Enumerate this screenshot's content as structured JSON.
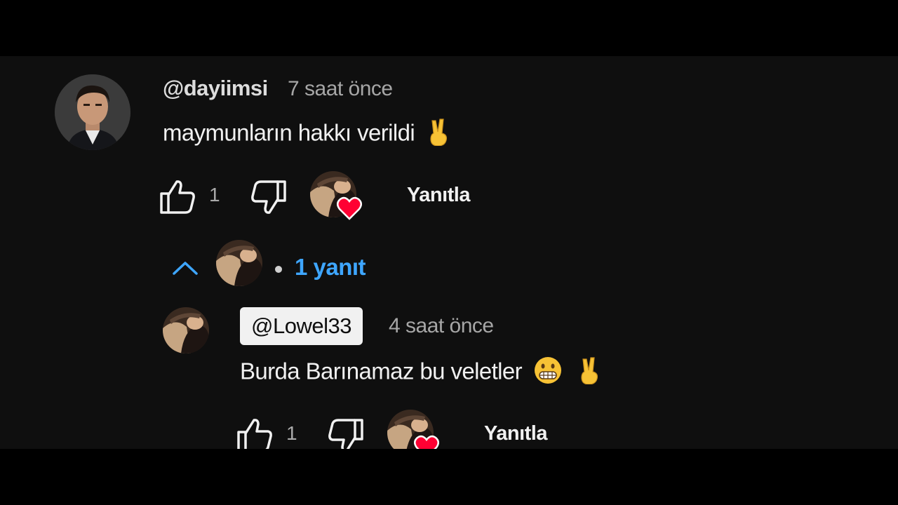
{
  "comment": {
    "author": "@dayiimsi",
    "time": "7 saat önce",
    "text": "maymunların hakkı verildi",
    "text_emoji": "victory-hand",
    "like_count": "1",
    "reply_label": "Yanıtla"
  },
  "replies_toggle": {
    "separator": "•",
    "label": "1 yanıt"
  },
  "reply": {
    "author": "@Lowel33",
    "time": "4 saat önce",
    "text": "Burda Barınamaz bu veletler",
    "text_emojis": [
      "grimacing-face",
      "victory-hand"
    ],
    "like_count": "1",
    "reply_label": "Yanıtla"
  },
  "colors": {
    "background": "#0f0f0f",
    "link": "#3ea6ff",
    "heart": "#ff0033"
  }
}
